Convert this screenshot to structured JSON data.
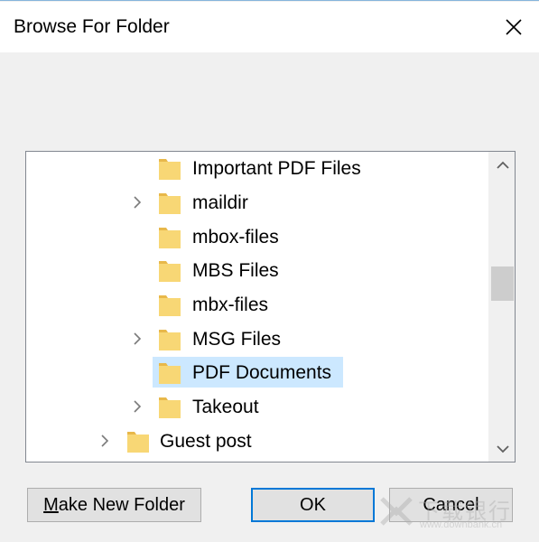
{
  "dialog": {
    "title": "Browse For Folder",
    "close_icon": "close-icon"
  },
  "tree": {
    "items": [
      {
        "label": "Important PDF Files",
        "expandable": false,
        "selected": false
      },
      {
        "label": "maildir",
        "expandable": true,
        "selected": false
      },
      {
        "label": "mbox-files",
        "expandable": false,
        "selected": false
      },
      {
        "label": "MBS Files",
        "expandable": false,
        "selected": false
      },
      {
        "label": "mbx-files",
        "expandable": false,
        "selected": false
      },
      {
        "label": "MSG Files",
        "expandable": true,
        "selected": false
      },
      {
        "label": "PDF Documents",
        "expandable": false,
        "selected": true
      },
      {
        "label": "Takeout",
        "expandable": true,
        "selected": false
      },
      {
        "label": "Guest post",
        "expandable": true,
        "selected": false
      }
    ]
  },
  "buttons": {
    "make_new_folder_first": "M",
    "make_new_folder_rest": "ake New Folder",
    "ok": "OK",
    "cancel": "Cancel"
  },
  "watermark": {
    "cn": "下载银行",
    "url": "www.downbank.cn"
  },
  "colors": {
    "selection": "#cce8ff",
    "default_button_border": "#0078d7",
    "folder_yellow": "#f8d775"
  }
}
